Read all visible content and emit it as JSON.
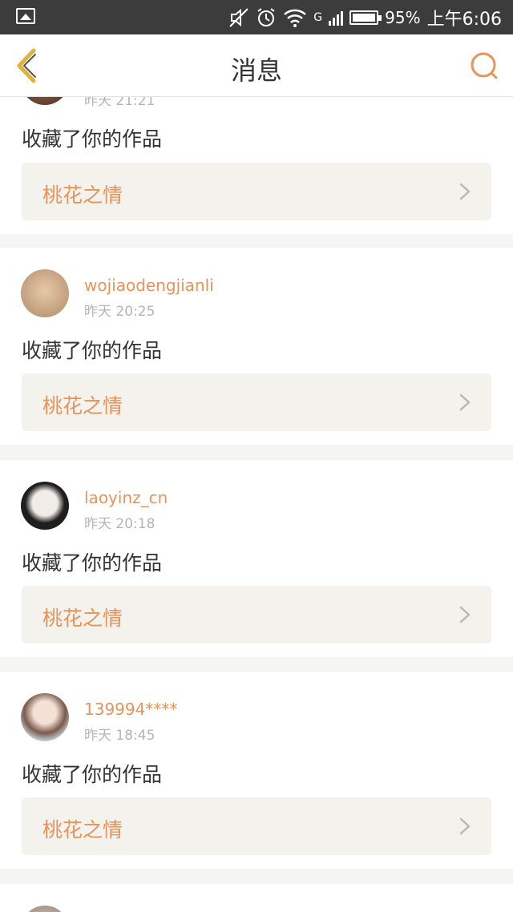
{
  "status_bar": {
    "battery_percent": "95%",
    "time": "上午6:06",
    "network": "G"
  },
  "header": {
    "title": "消息"
  },
  "messages": [
    {
      "username": "",
      "time": "昨天 21:21",
      "action": "收藏了你的作品",
      "work_title": "桃花之情"
    },
    {
      "username": "wojiaodengjianli",
      "time": "昨天 20:25",
      "action": "收藏了你的作品",
      "work_title": "桃花之情"
    },
    {
      "username": "laoyinz_cn",
      "time": "昨天 20:18",
      "action": "收藏了你的作品",
      "work_title": "桃花之情"
    },
    {
      "username": "139994****",
      "time": "昨天 18:45",
      "action": "收藏了你的作品",
      "work_title": "桃花之情"
    }
  ],
  "colors": {
    "accent": "#e8935a",
    "back_icon": "#e0b33a",
    "status_bar": "#3c3c3c"
  }
}
